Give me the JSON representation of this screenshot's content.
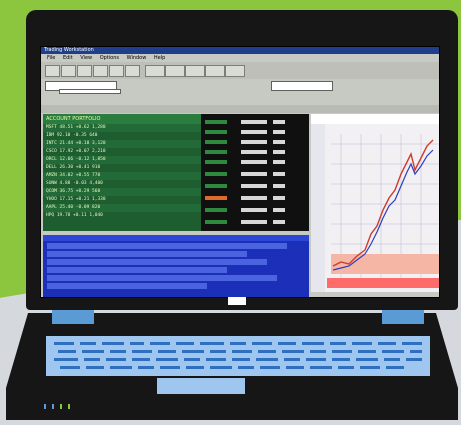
{
  "window": {
    "title": "Trading Workstation",
    "menu": [
      "File",
      "Edit",
      "View",
      "Options",
      "Window",
      "Help"
    ]
  },
  "toolbar": {
    "combo_1": "",
    "combo_2": ""
  },
  "panels": {
    "quotes_header": "ACCOUNT PORTFOLIO",
    "quotes_rows": [
      "MSFT  48.51  +0.62  1,280",
      "IBM   92.10  -0.35    640",
      "INTC  21.44  +0.18  3,120",
      "CSCO  17.92  +0.07  2,210",
      "ORCL  12.66  -0.12  1,850",
      "DELL  26.30  +0.41    910",
      "AMZN  34.02  +0.55    770",
      "SUNW   4.88  -0.03  4,400",
      "QCOM  36.75  +0.29    560",
      "YHOO  17.15  +0.21  1,330",
      "AAPL  25.40  -0.09    820",
      "HPQ   19.78  +0.11  1,040"
    ]
  },
  "colors": {
    "background_green": "#8cc63f",
    "background_gray": "#d5d8dd",
    "laptop_body": "#161616",
    "accent_blue": "#5b9bd5",
    "keyboard": "#9fc6ee",
    "quote_panel": "#1d5d30",
    "news_panel": "#1b2fb8"
  },
  "icons": {
    "status_leds": [
      "led-icon",
      "led-icon",
      "led-icon",
      "led-icon"
    ],
    "laptop_logo": "badge-icon"
  }
}
